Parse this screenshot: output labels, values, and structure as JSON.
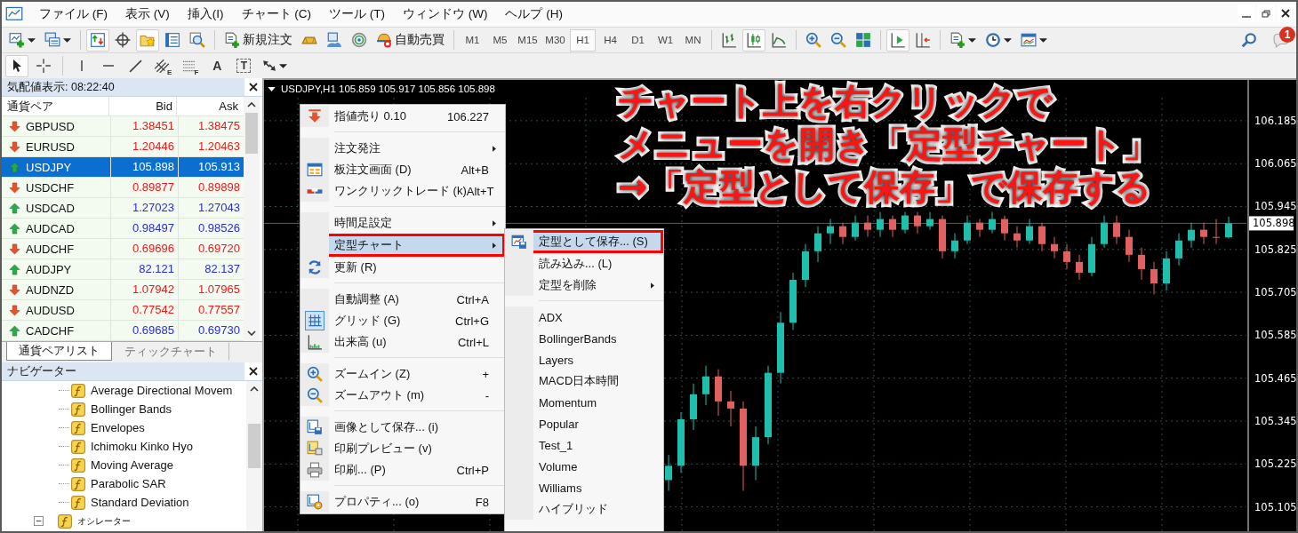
{
  "menu_bar": [
    "ファイル (F)",
    "表示 (V)",
    "挿入(I)",
    "チャート (C)",
    "ツール (T)",
    "ウィンドウ (W)",
    "ヘルプ (H)"
  ],
  "toolbar": {
    "items": [
      {
        "kind": "icon",
        "dropdown": true,
        "selected": false
      },
      {
        "kind": "icon",
        "dropdown": true,
        "selected": false
      },
      {
        "kind": "separator"
      },
      {
        "kind": "icon",
        "dropdown": false,
        "selected": true
      },
      {
        "kind": "icon",
        "dropdown": false,
        "selected": false
      },
      {
        "kind": "icon",
        "dropdown": false,
        "selected": true
      },
      {
        "kind": "icon",
        "dropdown": false,
        "selected": false
      },
      {
        "kind": "icon",
        "dropdown": false,
        "selected": false
      },
      {
        "kind": "separator"
      },
      {
        "kind": "icon",
        "label": "新規注文",
        "dropdown": false,
        "selected": false
      },
      {
        "kind": "icon",
        "dropdown": false,
        "selected": false
      },
      {
        "kind": "icon",
        "dropdown": false,
        "selected": false
      },
      {
        "kind": "icon",
        "dropdown": false,
        "selected": false
      },
      {
        "kind": "icon",
        "label": "自動売買",
        "dropdown": false,
        "selected": false
      },
      {
        "kind": "separator"
      },
      {
        "kind": "timeframe",
        "label": "M1",
        "selected": false
      },
      {
        "kind": "timeframe",
        "label": "M5",
        "selected": false
      },
      {
        "kind": "timeframe",
        "label": "M15",
        "selected": false
      },
      {
        "kind": "timeframe",
        "label": "M30",
        "selected": false
      },
      {
        "kind": "timeframe",
        "label": "H1",
        "selected": true
      },
      {
        "kind": "timeframe",
        "label": "H4",
        "selected": false
      },
      {
        "kind": "timeframe",
        "label": "D1",
        "selected": false
      },
      {
        "kind": "timeframe",
        "label": "W1",
        "selected": false
      },
      {
        "kind": "timeframe",
        "label": "MN",
        "selected": false
      },
      {
        "kind": "separator"
      },
      {
        "kind": "icon",
        "dropdown": false,
        "selected": false
      },
      {
        "kind": "icon",
        "dropdown": false,
        "selected": true
      },
      {
        "kind": "icon",
        "dropdown": false,
        "selected": false
      },
      {
        "kind": "separator"
      },
      {
        "kind": "icon",
        "dropdown": false,
        "selected": false
      },
      {
        "kind": "icon",
        "dropdown": false,
        "selected": false
      },
      {
        "kind": "icon",
        "dropdown": false,
        "selected": false
      },
      {
        "kind": "separator"
      },
      {
        "kind": "icon",
        "dropdown": false,
        "selected": true
      },
      {
        "kind": "icon",
        "dropdown": false,
        "selected": false
      },
      {
        "kind": "separator"
      },
      {
        "kind": "icon",
        "dropdown": true,
        "selected": false
      },
      {
        "kind": "icon",
        "dropdown": true,
        "selected": false
      },
      {
        "kind": "icon",
        "dropdown": true,
        "selected": false
      }
    ]
  },
  "notifications": {
    "badge": "1"
  },
  "drawing_toolbar": {
    "items": [
      {
        "kind": "tool",
        "selected": true,
        "dropdown": false
      },
      {
        "kind": "tool",
        "selected": false,
        "dropdown": false
      },
      {
        "kind": "separator"
      },
      {
        "kind": "tool",
        "selected": false,
        "dropdown": false
      },
      {
        "kind": "tool",
        "selected": false,
        "dropdown": false
      },
      {
        "kind": "tool",
        "selected": false,
        "dropdown": false
      },
      {
        "kind": "tool",
        "glyph": "E",
        "selected": false,
        "dropdown": false
      },
      {
        "kind": "tool",
        "glyph": "F",
        "selected": false,
        "dropdown": false
      },
      {
        "kind": "tool",
        "glyph": "A",
        "selected": false,
        "dropdown": false
      },
      {
        "kind": "tool",
        "glyph": "T",
        "selected": false,
        "dropdown": false
      },
      {
        "kind": "tool",
        "selected": false,
        "dropdown": true
      }
    ]
  },
  "market_watch": {
    "title": "気配値表示: 08:22:40",
    "columns": [
      "通貨ペア",
      "Bid",
      "Ask"
    ],
    "rows": [
      {
        "symbol": "GBPUSD",
        "bid": "1.38451",
        "ask": "1.38475",
        "kind": "down",
        "selected": false
      },
      {
        "symbol": "EURUSD",
        "bid": "1.20446",
        "ask": "1.20463",
        "kind": "down",
        "selected": false
      },
      {
        "symbol": "USDJPY",
        "bid": "105.898",
        "ask": "105.913",
        "kind": "up",
        "selected": true
      },
      {
        "symbol": "USDCHF",
        "bid": "0.89877",
        "ask": "0.89898",
        "kind": "down",
        "selected": false
      },
      {
        "symbol": "USDCAD",
        "bid": "1.27023",
        "ask": "1.27043",
        "kind": "up",
        "selected": false
      },
      {
        "symbol": "AUDCAD",
        "bid": "0.98497",
        "ask": "0.98526",
        "kind": "up",
        "selected": false
      },
      {
        "symbol": "AUDCHF",
        "bid": "0.69696",
        "ask": "0.69720",
        "kind": "down",
        "selected": false
      },
      {
        "symbol": "AUDJPY",
        "bid": "82.121",
        "ask": "82.137",
        "kind": "up",
        "selected": false
      },
      {
        "symbol": "AUDNZD",
        "bid": "1.07942",
        "ask": "1.07965",
        "kind": "down",
        "selected": false
      },
      {
        "symbol": "AUDUSD",
        "bid": "0.77542",
        "ask": "0.77557",
        "kind": "down",
        "selected": false
      },
      {
        "symbol": "CADCHF",
        "bid": "0.69685",
        "ask": "0.69730",
        "kind": "up",
        "selected": false
      }
    ],
    "tabs": [
      {
        "label": "通貨ペアリスト",
        "selected": true
      },
      {
        "label": "ティックチャート",
        "selected": false
      }
    ]
  },
  "navigator": {
    "title": "ナビゲーター",
    "tree": [
      {
        "children": [
          {
            "label": "Average Directional Movem"
          },
          {
            "label": "Bollinger Bands"
          },
          {
            "label": "Envelopes"
          },
          {
            "label": "Ichimoku Kinko Hyo"
          },
          {
            "label": "Moving Average"
          },
          {
            "label": "Parabolic SAR"
          },
          {
            "label": "Standard Deviation"
          }
        ]
      },
      {
        "label": "オシレーター",
        "expanded": true
      }
    ]
  },
  "chart": {
    "title": "USDJPY,H1 105.859 105.917 105.856 105.898",
    "current_price": "105.898",
    "chart_data": {
      "type": "candlestick",
      "grid": true,
      "ylim": [
        105.037,
        106.299
      ],
      "ref_lines": [
        {
          "axis": "y",
          "value": 105.898
        }
      ],
      "categories": [
        null,
        null,
        null,
        null,
        null,
        null,
        null,
        null,
        null,
        null,
        null,
        null,
        null,
        null,
        null,
        null,
        null,
        null,
        null,
        null,
        null,
        null,
        null,
        null,
        null,
        null,
        null,
        null,
        null,
        null,
        null,
        null,
        null,
        null,
        null,
        null,
        null,
        null,
        null,
        null,
        null,
        null,
        null,
        null,
        null,
        null
      ],
      "ohlc": [
        [
          105.18,
          105.25,
          105.15,
          105.22
        ],
        [
          105.22,
          105.37,
          105.2,
          105.35
        ],
        [
          105.35,
          105.45,
          105.32,
          105.42
        ],
        [
          105.42,
          105.5,
          105.39,
          105.47
        ],
        [
          105.47,
          105.49,
          105.36,
          105.4
        ],
        [
          105.4,
          105.43,
          105.33,
          105.38
        ],
        [
          105.38,
          105.4,
          105.15,
          105.22
        ],
        [
          105.22,
          105.33,
          105.18,
          105.3
        ],
        [
          105.3,
          105.5,
          105.28,
          105.48
        ],
        [
          105.48,
          105.65,
          105.45,
          105.62
        ],
        [
          105.62,
          105.76,
          105.6,
          105.74
        ],
        [
          105.74,
          105.84,
          105.72,
          105.82
        ],
        [
          105.82,
          105.89,
          105.79,
          105.87
        ],
        [
          105.87,
          105.91,
          105.84,
          105.89
        ],
        [
          105.89,
          105.9,
          105.84,
          105.86
        ],
        [
          105.86,
          105.92,
          105.85,
          105.9
        ],
        [
          105.9,
          105.92,
          105.86,
          105.88
        ],
        [
          105.88,
          105.93,
          105.86,
          105.91
        ],
        [
          105.91,
          105.92,
          105.86,
          105.88
        ],
        [
          105.88,
          105.93,
          105.87,
          105.92
        ],
        [
          105.92,
          105.93,
          105.87,
          105.89
        ],
        [
          105.89,
          105.93,
          105.88,
          105.91
        ],
        [
          105.91,
          105.92,
          105.8,
          105.82
        ],
        [
          105.82,
          105.87,
          105.8,
          105.85
        ],
        [
          105.85,
          105.92,
          105.84,
          105.9
        ],
        [
          105.9,
          105.91,
          105.86,
          105.88
        ],
        [
          105.88,
          105.93,
          105.87,
          105.91
        ],
        [
          105.91,
          105.92,
          105.85,
          105.87
        ],
        [
          105.87,
          105.89,
          105.83,
          105.85
        ],
        [
          105.85,
          105.91,
          105.84,
          105.89
        ],
        [
          105.89,
          105.9,
          105.82,
          105.84
        ],
        [
          105.84,
          105.86,
          105.8,
          105.82
        ],
        [
          105.82,
          105.84,
          105.77,
          105.79
        ],
        [
          105.79,
          105.81,
          105.74,
          105.76
        ],
        [
          105.76,
          105.86,
          105.75,
          105.84
        ],
        [
          105.84,
          105.92,
          105.83,
          105.9
        ],
        [
          105.9,
          105.92,
          105.84,
          105.86
        ],
        [
          105.86,
          105.88,
          105.79,
          105.81
        ],
        [
          105.81,
          105.83,
          105.74,
          105.77
        ],
        [
          105.77,
          105.79,
          105.7,
          105.73
        ],
        [
          105.73,
          105.82,
          105.71,
          105.8
        ],
        [
          105.8,
          105.87,
          105.78,
          105.85
        ],
        [
          105.85,
          105.9,
          105.83,
          105.88
        ],
        [
          105.88,
          105.9,
          105.84,
          105.86
        ],
        [
          105.86,
          105.91,
          105.84,
          105.859
        ],
        [
          105.859,
          105.917,
          105.856,
          105.898
        ]
      ],
      "yticks": [
        106.185,
        106.065,
        105.945,
        105.825,
        105.705,
        105.585,
        105.465,
        105.345,
        105.225,
        105.105
      ]
    }
  },
  "annotation": [
    "チャート上を右クリックで",
    "メニューを開き「定型チャート」",
    "→「定型として保存」で保存する"
  ],
  "context_menu": {
    "items": [
      {
        "kind": "item",
        "label": "指値売り 0.10",
        "shortcut": "106.227",
        "submenu": false,
        "selected": false,
        "framed": false,
        "checked": false
      },
      {
        "kind": "separator"
      },
      {
        "kind": "item",
        "label": "注文発注",
        "submenu": true,
        "selected": false,
        "framed": false,
        "checked": false
      },
      {
        "kind": "item",
        "label": "板注文画面 (D)",
        "shortcut": "Alt+B",
        "submenu": false,
        "selected": false,
        "framed": false,
        "checked": false
      },
      {
        "kind": "item",
        "label": "ワンクリックトレード (k)",
        "shortcut": "Alt+T",
        "submenu": false,
        "selected": false,
        "framed": false,
        "checked": false
      },
      {
        "kind": "separator"
      },
      {
        "kind": "item",
        "label": "時間足設定",
        "submenu": true,
        "selected": false,
        "framed": false,
        "checked": false
      },
      {
        "kind": "item",
        "label": "定型チャート",
        "submenu": true,
        "selected": true,
        "framed": true,
        "checked": false
      },
      {
        "kind": "item",
        "label": "更新 (R)",
        "submenu": false,
        "selected": false,
        "framed": false,
        "checked": false
      },
      {
        "kind": "separator"
      },
      {
        "kind": "item",
        "label": "自動調整 (A)",
        "shortcut": "Ctrl+A",
        "submenu": false,
        "selected": false,
        "framed": false,
        "checked": false
      },
      {
        "kind": "item",
        "label": "グリッド (G)",
        "shortcut": "Ctrl+G",
        "submenu": false,
        "selected": false,
        "framed": false,
        "checked": true
      },
      {
        "kind": "item",
        "label": "出来高 (u)",
        "shortcut": "Ctrl+L",
        "submenu": false,
        "selected": false,
        "framed": false,
        "checked": false
      },
      {
        "kind": "separator"
      },
      {
        "kind": "item",
        "label": "ズームイン (Z)",
        "shortcut": "+",
        "submenu": false,
        "selected": false,
        "framed": false,
        "checked": false
      },
      {
        "kind": "item",
        "label": "ズームアウト (m)",
        "shortcut": "-",
        "submenu": false,
        "selected": false,
        "framed": false,
        "checked": false
      },
      {
        "kind": "separator"
      },
      {
        "kind": "item",
        "label": "画像として保存... (i)",
        "submenu": false,
        "selected": false,
        "framed": false,
        "checked": false
      },
      {
        "kind": "item",
        "label": "印刷プレビュー (v)",
        "submenu": false,
        "selected": false,
        "framed": false,
        "checked": false
      },
      {
        "kind": "item",
        "label": "印刷... (P)",
        "shortcut": "Ctrl+P",
        "submenu": false,
        "selected": false,
        "framed": false,
        "checked": false
      },
      {
        "kind": "separator"
      },
      {
        "kind": "item",
        "label": "プロパティ... (o)",
        "shortcut": "F8",
        "submenu": false,
        "selected": false,
        "framed": false,
        "checked": false
      }
    ]
  },
  "template_submenu": {
    "items": [
      {
        "kind": "item",
        "label": "定型として保存... (S)",
        "submenu": false,
        "selected": true,
        "framed": true
      },
      {
        "kind": "item",
        "label": "読み込み... (L)",
        "submenu": false,
        "selected": false,
        "framed": false
      },
      {
        "kind": "item",
        "label": "定型を削除",
        "submenu": true,
        "selected": false,
        "framed": false
      },
      {
        "kind": "separator"
      },
      {
        "kind": "item",
        "label": "ADX",
        "submenu": false,
        "selected": false,
        "framed": false
      },
      {
        "kind": "item",
        "label": "BollingerBands",
        "submenu": false,
        "selected": false,
        "framed": false
      },
      {
        "kind": "item",
        "label": "Layers",
        "submenu": false,
        "selected": false,
        "framed": false
      },
      {
        "kind": "item",
        "label": "MACD日本時間",
        "submenu": false,
        "selected": false,
        "framed": false
      },
      {
        "kind": "item",
        "label": "Momentum",
        "submenu": false,
        "selected": false,
        "framed": false
      },
      {
        "kind": "item",
        "label": "Popular",
        "submenu": false,
        "selected": false,
        "framed": false
      },
      {
        "kind": "item",
        "label": "Test_1",
        "submenu": false,
        "selected": false,
        "framed": false
      },
      {
        "kind": "item",
        "label": "Volume",
        "submenu": false,
        "selected": false,
        "framed": false
      },
      {
        "kind": "item",
        "label": "Williams",
        "submenu": false,
        "selected": false,
        "framed": false
      },
      {
        "kind": "item",
        "label": "ハイブリッド",
        "submenu": false,
        "selected": false,
        "framed": false
      }
    ]
  }
}
